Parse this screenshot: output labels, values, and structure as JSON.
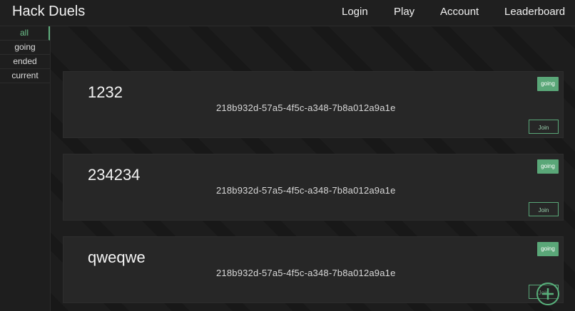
{
  "app": {
    "title": "Hack Duels"
  },
  "nav": {
    "login": "Login",
    "play": "Play",
    "account": "Account",
    "leaderboard": "Leaderboard"
  },
  "sidebar": {
    "items": [
      {
        "label": "all",
        "active": true
      },
      {
        "label": "going"
      },
      {
        "label": "ended"
      },
      {
        "label": "current"
      }
    ]
  },
  "duels": [
    {
      "name": "1232",
      "id": "218b932d-57a5-4f5c-a348-7b8a012a9a1e",
      "status": "going",
      "action": "Join"
    },
    {
      "name": "234234",
      "id": "218b932d-57a5-4f5c-a348-7b8a012a9a1e",
      "status": "going",
      "action": "Join"
    },
    {
      "name": "qweqwe",
      "id": "218b932d-57a5-4f5c-a348-7b8a012a9a1e",
      "status": "going",
      "action": "Join"
    }
  ],
  "fab": {
    "icon": "plus-icon"
  },
  "colors": {
    "accent": "#5aa778",
    "background": "#1c1c1c",
    "card": "#272727"
  }
}
